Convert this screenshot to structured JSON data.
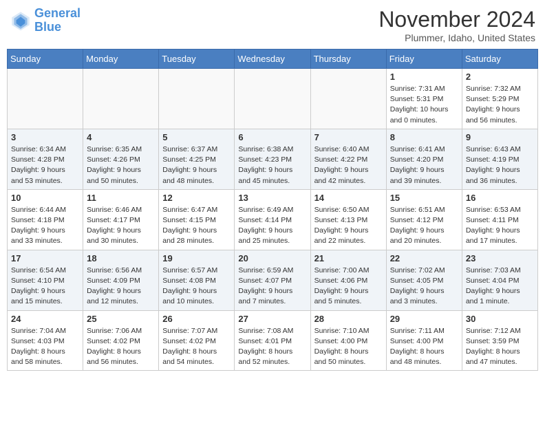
{
  "header": {
    "logo_line1": "General",
    "logo_line2": "Blue",
    "month": "November 2024",
    "location": "Plummer, Idaho, United States"
  },
  "weekdays": [
    "Sunday",
    "Monday",
    "Tuesday",
    "Wednesday",
    "Thursday",
    "Friday",
    "Saturday"
  ],
  "weeks": [
    [
      {
        "day": "",
        "info": ""
      },
      {
        "day": "",
        "info": ""
      },
      {
        "day": "",
        "info": ""
      },
      {
        "day": "",
        "info": ""
      },
      {
        "day": "",
        "info": ""
      },
      {
        "day": "1",
        "info": "Sunrise: 7:31 AM\nSunset: 5:31 PM\nDaylight: 10 hours\nand 0 minutes."
      },
      {
        "day": "2",
        "info": "Sunrise: 7:32 AM\nSunset: 5:29 PM\nDaylight: 9 hours\nand 56 minutes."
      }
    ],
    [
      {
        "day": "3",
        "info": "Sunrise: 6:34 AM\nSunset: 4:28 PM\nDaylight: 9 hours\nand 53 minutes."
      },
      {
        "day": "4",
        "info": "Sunrise: 6:35 AM\nSunset: 4:26 PM\nDaylight: 9 hours\nand 50 minutes."
      },
      {
        "day": "5",
        "info": "Sunrise: 6:37 AM\nSunset: 4:25 PM\nDaylight: 9 hours\nand 48 minutes."
      },
      {
        "day": "6",
        "info": "Sunrise: 6:38 AM\nSunset: 4:23 PM\nDaylight: 9 hours\nand 45 minutes."
      },
      {
        "day": "7",
        "info": "Sunrise: 6:40 AM\nSunset: 4:22 PM\nDaylight: 9 hours\nand 42 minutes."
      },
      {
        "day": "8",
        "info": "Sunrise: 6:41 AM\nSunset: 4:20 PM\nDaylight: 9 hours\nand 39 minutes."
      },
      {
        "day": "9",
        "info": "Sunrise: 6:43 AM\nSunset: 4:19 PM\nDaylight: 9 hours\nand 36 minutes."
      }
    ],
    [
      {
        "day": "10",
        "info": "Sunrise: 6:44 AM\nSunset: 4:18 PM\nDaylight: 9 hours\nand 33 minutes."
      },
      {
        "day": "11",
        "info": "Sunrise: 6:46 AM\nSunset: 4:17 PM\nDaylight: 9 hours\nand 30 minutes."
      },
      {
        "day": "12",
        "info": "Sunrise: 6:47 AM\nSunset: 4:15 PM\nDaylight: 9 hours\nand 28 minutes."
      },
      {
        "day": "13",
        "info": "Sunrise: 6:49 AM\nSunset: 4:14 PM\nDaylight: 9 hours\nand 25 minutes."
      },
      {
        "day": "14",
        "info": "Sunrise: 6:50 AM\nSunset: 4:13 PM\nDaylight: 9 hours\nand 22 minutes."
      },
      {
        "day": "15",
        "info": "Sunrise: 6:51 AM\nSunset: 4:12 PM\nDaylight: 9 hours\nand 20 minutes."
      },
      {
        "day": "16",
        "info": "Sunrise: 6:53 AM\nSunset: 4:11 PM\nDaylight: 9 hours\nand 17 minutes."
      }
    ],
    [
      {
        "day": "17",
        "info": "Sunrise: 6:54 AM\nSunset: 4:10 PM\nDaylight: 9 hours\nand 15 minutes."
      },
      {
        "day": "18",
        "info": "Sunrise: 6:56 AM\nSunset: 4:09 PM\nDaylight: 9 hours\nand 12 minutes."
      },
      {
        "day": "19",
        "info": "Sunrise: 6:57 AM\nSunset: 4:08 PM\nDaylight: 9 hours\nand 10 minutes."
      },
      {
        "day": "20",
        "info": "Sunrise: 6:59 AM\nSunset: 4:07 PM\nDaylight: 9 hours\nand 7 minutes."
      },
      {
        "day": "21",
        "info": "Sunrise: 7:00 AM\nSunset: 4:06 PM\nDaylight: 9 hours\nand 5 minutes."
      },
      {
        "day": "22",
        "info": "Sunrise: 7:02 AM\nSunset: 4:05 PM\nDaylight: 9 hours\nand 3 minutes."
      },
      {
        "day": "23",
        "info": "Sunrise: 7:03 AM\nSunset: 4:04 PM\nDaylight: 9 hours\nand 1 minute."
      }
    ],
    [
      {
        "day": "24",
        "info": "Sunrise: 7:04 AM\nSunset: 4:03 PM\nDaylight: 8 hours\nand 58 minutes."
      },
      {
        "day": "25",
        "info": "Sunrise: 7:06 AM\nSunset: 4:02 PM\nDaylight: 8 hours\nand 56 minutes."
      },
      {
        "day": "26",
        "info": "Sunrise: 7:07 AM\nSunset: 4:02 PM\nDaylight: 8 hours\nand 54 minutes."
      },
      {
        "day": "27",
        "info": "Sunrise: 7:08 AM\nSunset: 4:01 PM\nDaylight: 8 hours\nand 52 minutes."
      },
      {
        "day": "28",
        "info": "Sunrise: 7:10 AM\nSunset: 4:00 PM\nDaylight: 8 hours\nand 50 minutes."
      },
      {
        "day": "29",
        "info": "Sunrise: 7:11 AM\nSunset: 4:00 PM\nDaylight: 8 hours\nand 48 minutes."
      },
      {
        "day": "30",
        "info": "Sunrise: 7:12 AM\nSunset: 3:59 PM\nDaylight: 8 hours\nand 47 minutes."
      }
    ]
  ]
}
